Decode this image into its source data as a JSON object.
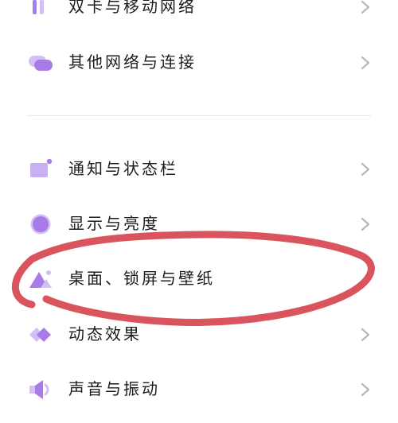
{
  "settings": {
    "items": [
      {
        "label": "双卡与移动网络",
        "icon": "sim-card-icon"
      },
      {
        "label": "其他网络与连接",
        "icon": "network-connection-icon"
      },
      {
        "label": "通知与状态栏",
        "icon": "notification-icon"
      },
      {
        "label": "显示与亮度",
        "icon": "display-brightness-icon"
      },
      {
        "label": "桌面、锁屏与壁纸",
        "icon": "wallpaper-icon"
      },
      {
        "label": "动态效果",
        "icon": "motion-effect-icon"
      },
      {
        "label": "声音与振动",
        "icon": "sound-icon"
      }
    ]
  },
  "colors": {
    "accent": "#a77be8",
    "accent_light": "#d3bff6",
    "annotation_red": "#d9545c",
    "chevron": "#b8b8b8",
    "text": "#1c1c1c"
  }
}
